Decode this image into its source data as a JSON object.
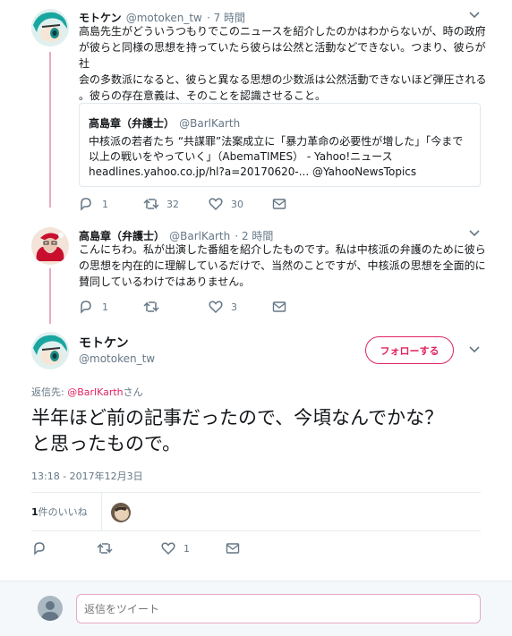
{
  "tweet1": {
    "name": "モトケン",
    "handle": "@motoken_tw",
    "time": "· 7 時間",
    "text_lines": [
      "高島先生がどういうつもりでこのニュースを紹介したのかはわからないが、時の政府",
      "が彼らと同様の思想を持っていたら彼らは公然と活動などできない。つまり、彼らが社",
      "会の多数派になると、彼らと異なる思想の少数派は公然活動できないほど弾圧される",
      "。彼らの存在意義は、そのことを認識させること。"
    ],
    "quote": {
      "name": "高島章（弁護士）",
      "handle": "@BarlKarth",
      "lines": [
        "中核派の若者たち “共謀罪”法案成立に「暴力革命の必要性が増した」「今まで",
        "以上の戦いをやっていく」（AbemaTIMES） - Yahoo!ニュース",
        "headlines.yahoo.co.jp/hl?a=20170620-... @YahooNewsTopics"
      ]
    },
    "replies": "1",
    "retweets": "32",
    "likes": "30"
  },
  "tweet2": {
    "name": "高島章（弁護士）",
    "handle": "@BarlKarth",
    "time": "· 2 時間",
    "text_lines": [
      "こんにちわ。私が出演した番組を紹介したものです。私は中核派の弁護のために彼ら",
      "の思想を内在的に理解しているだけで、当然のことですが、中核派の思想を全面的に",
      "賛同しているわけではありません。"
    ],
    "replies": "1",
    "retweets": "",
    "likes": "3"
  },
  "main": {
    "name": "モトケン",
    "handle": "@motoken_tw",
    "follow_label": "フォローする",
    "reply_to_prefix": "返信先: ",
    "reply_to_user": "@BarlKarth",
    "reply_to_suffix": "さん",
    "text_line1": "半年ほど前の記事だったので、今頃なんでかな？",
    "text_line2": "と思ったもので。",
    "timestamp": "13:18 - 2017年12月3日",
    "likes_count": "1",
    "likes_label": "件のいいね",
    "replies": "",
    "retweets": "",
    "likes": "1"
  },
  "composer": {
    "placeholder": "返信をツイート"
  },
  "colors": {
    "accent": "#e0245e",
    "thread_line": "#e6aac4",
    "muted": "#657786"
  }
}
